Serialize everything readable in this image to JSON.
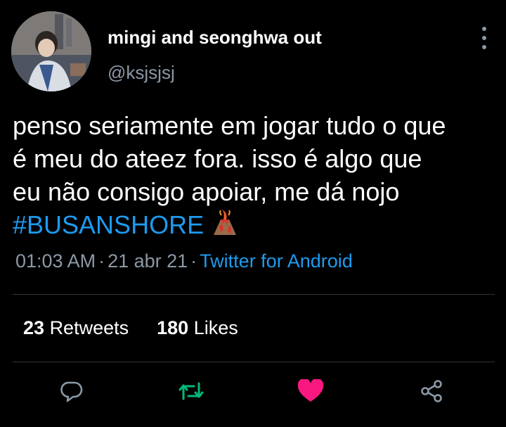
{
  "author": {
    "display_name": "mingi and seonghwa out",
    "handle": "@ksjsjsj",
    "avatar_icon": "profile-photo"
  },
  "tweet": {
    "lines": [
      "penso seriamente em jogar tudo o que",
      "é meu do ateez fora. isso é algo que",
      "eu não consigo apoiar, me dá nojo"
    ],
    "hashtag": "#BUSANSHORE",
    "emoji_icon": "volcano-icon"
  },
  "meta": {
    "time": "01:03 AM",
    "separator": "·",
    "date": "21 abr 21",
    "source": "Twitter for Android"
  },
  "stats": {
    "retweets_count": "23",
    "retweets_label": "Retweets",
    "likes_count": "180",
    "likes_label": "Likes"
  },
  "colors": {
    "background": "#000000",
    "muted": "#8b98a5",
    "link": "#1d9bf0",
    "retweet_active": "#00ba7c",
    "like_active": "#f91880",
    "divider": "#2f3336"
  },
  "actions": {
    "reply_icon": "reply-icon",
    "retweet_icon": "retweet-icon",
    "like_icon": "heart-icon",
    "share_icon": "share-icon"
  }
}
